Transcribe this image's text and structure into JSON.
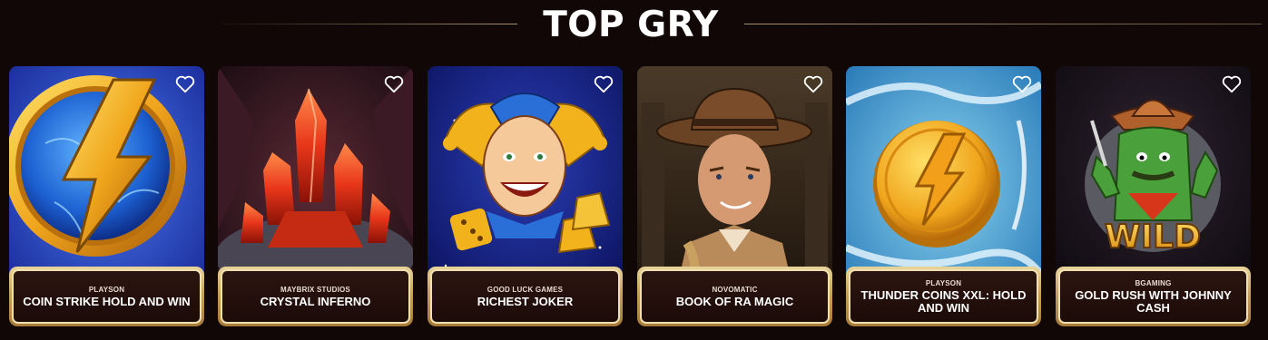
{
  "section": {
    "title": "TOP GRY"
  },
  "colors": {
    "background": "#110706",
    "gold_frame": "#c9a15b",
    "plate_bg": "#1c0b08"
  },
  "games": [
    {
      "provider": "PLAYSON",
      "name": "COIN STRIKE HOLD AND WIN",
      "art": "lightning-coin-icon",
      "favorite_icon": "heart-outline-icon"
    },
    {
      "provider": "MAYBRIX STUDIOS",
      "name": "CRYSTAL INFERNO",
      "art": "red-crystal-icon",
      "favorite_icon": "heart-outline-icon"
    },
    {
      "provider": "GOOD LUCK GAMES",
      "name": "RICHEST JOKER",
      "art": "joker-icon",
      "favorite_icon": "heart-outline-icon"
    },
    {
      "provider": "NOVOMATIC",
      "name": "BOOK OF RA MAGIC",
      "art": "explorer-icon",
      "favorite_icon": "heart-outline-icon"
    },
    {
      "provider": "PLAYSON",
      "name": "THUNDER COINS XXL: HOLD AND WIN",
      "art": "thunder-coin-icon",
      "favorite_icon": "heart-outline-icon"
    },
    {
      "provider": "BGAMING",
      "name": "GOLD RUSH WITH JOHNNY CASH",
      "art": "cactus-cowboy-wild-icon",
      "favorite_icon": "heart-outline-icon"
    }
  ]
}
